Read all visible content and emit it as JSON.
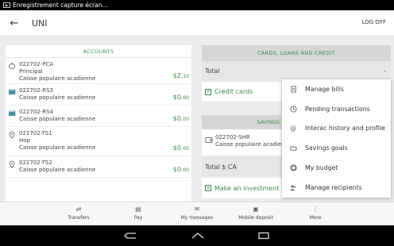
{
  "status_bar": {
    "notification": "Enregistrement capture écran..."
  },
  "app_bar": {
    "title": "UNI",
    "logoff": "LOG OFF"
  },
  "accounts": {
    "header": "ACCOUNTS",
    "items": [
      {
        "number": "022702-PCA",
        "name": "Principal",
        "institution": "Caisse populaire acadienne",
        "amount_main": "$2.",
        "amount_cents": "10",
        "icon": "piggy-bank-icon"
      },
      {
        "number": "022702-RS3",
        "name": "",
        "institution": "Caisse populaire acadienne",
        "amount_main": "$0.",
        "amount_cents": "00",
        "icon": "money-bills-icon"
      },
      {
        "number": "022702-RS4",
        "name": "",
        "institution": "Caisse populaire acadienne",
        "amount_main": "$0.",
        "amount_cents": "00",
        "icon": "money-bills-icon"
      },
      {
        "number": "022702-TS1",
        "name": "Hop",
        "institution": "Caisse populaire acadienne",
        "amount_main": "$0.",
        "amount_cents": "00",
        "icon": "location-pin-icon"
      },
      {
        "number": "022702-TS2",
        "name": "",
        "institution": "Caisse populaire acadienne",
        "amount_main": "$0.",
        "amount_cents": "00",
        "icon": "location-pin-icon"
      }
    ]
  },
  "cards": {
    "header": "CARDS, LOANS AND CREDIT",
    "total_label": "Total",
    "total_value": "-",
    "credit_cards": "Credit cards"
  },
  "savings": {
    "header": "SAVINGS",
    "account_number": "022702-SHR",
    "institution": "Caisse populaire acadien",
    "total_label": "Total $ CA",
    "make_investment": "Make an investment"
  },
  "overflow_menu": [
    {
      "label": "Manage bills",
      "icon": "bills-icon"
    },
    {
      "label": "Pending transactions",
      "icon": "clock-icon"
    },
    {
      "label": "Interac history and profile",
      "icon": "at-sign-icon"
    },
    {
      "label": "Savings goals",
      "icon": "folder-icon"
    },
    {
      "label": "My budget",
      "icon": "donut-chart-icon"
    },
    {
      "label": "Manage recipients",
      "icon": "people-icon"
    }
  ],
  "bottom_nav": [
    {
      "label": "Transfers",
      "icon": "transfer-icon"
    },
    {
      "label": "Pay",
      "icon": "invoice-icon"
    },
    {
      "label": "My messages",
      "icon": "envelope-icon"
    },
    {
      "label": "Mobile deposit",
      "icon": "cheque-icon"
    },
    {
      "label": "More",
      "icon": "more-vertical-icon"
    }
  ],
  "colors": {
    "accent": "#3b8a4e",
    "background": "#ececec"
  }
}
